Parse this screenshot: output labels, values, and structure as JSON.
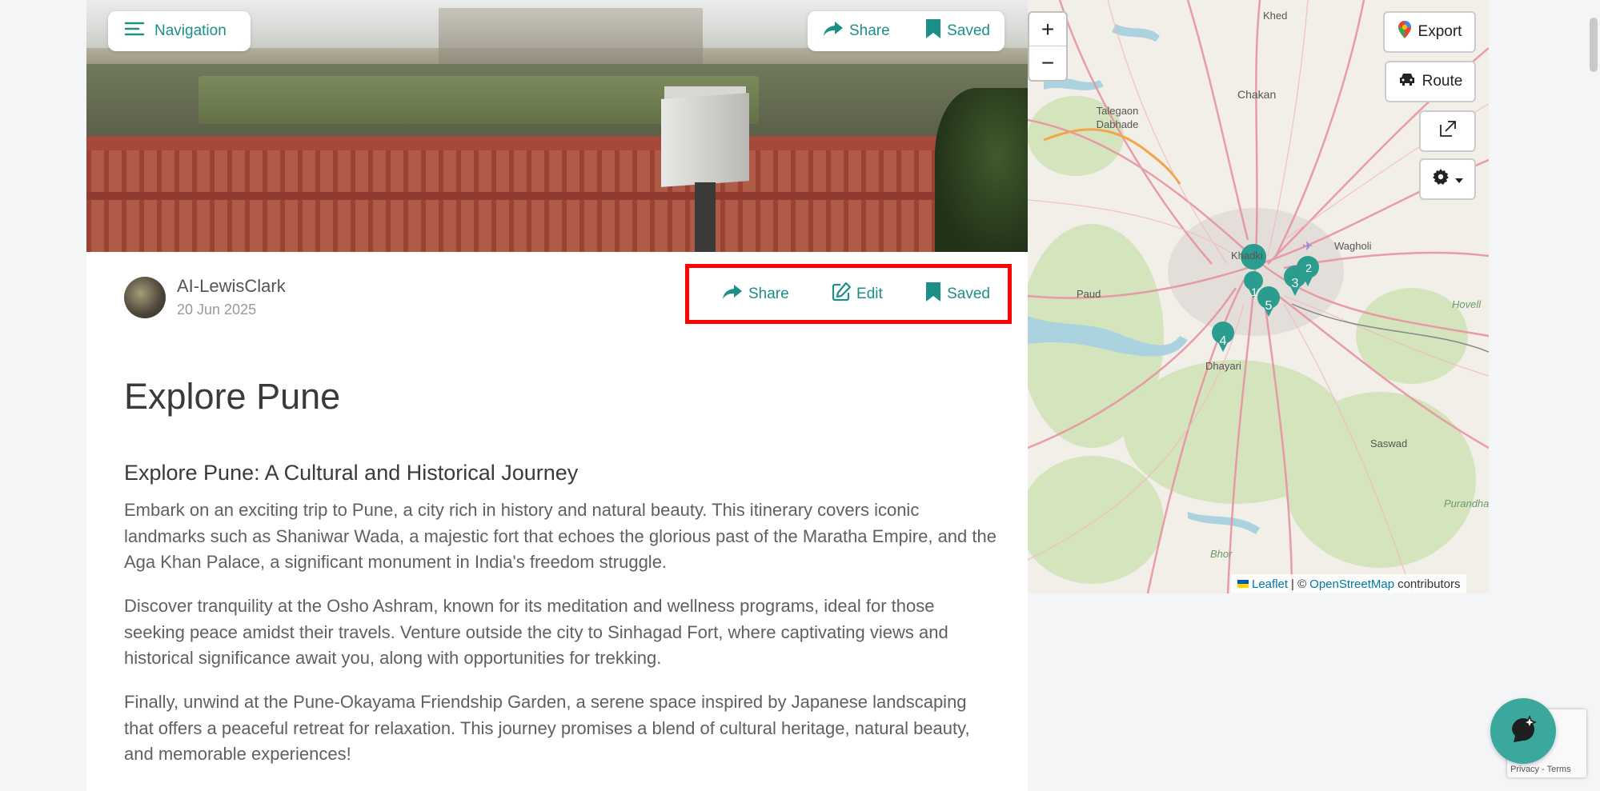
{
  "hero": {
    "nav_label": "Navigation",
    "share_label": "Share",
    "saved_label": "Saved"
  },
  "author": {
    "name": "AI-LewisClark",
    "date": "20 Jun 2025"
  },
  "actions": {
    "share_label": "Share",
    "edit_label": "Edit",
    "saved_label": "Saved"
  },
  "article": {
    "title": "Explore Pune",
    "subtitle": "Explore Pune: A Cultural and Historical Journey",
    "paragraphs": [
      "Embark on an exciting trip to Pune, a city rich in history and natural beauty. This itinerary covers iconic landmarks such as Shaniwar Wada, a majestic fort that echoes the glorious past of the Maratha Empire, and the Aga Khan Palace, a significant monument in India's freedom struggle.",
      "Discover tranquility at the Osho Ashram, known for its meditation and wellness programs, ideal for those seeking peace amidst their travels. Venture outside the city to Sinhagad Fort, where captivating views and historical significance await you, along with opportunities for trekking.",
      "Finally, unwind at the Pune-Okayama Friendship Garden, a serene space inspired by Japanese landscaping that offers a peaceful retreat for relaxation. This journey promises a blend of cultural heritage, natural beauty, and memorable experiences!"
    ]
  },
  "map": {
    "zoom_in": "+",
    "zoom_out": "−",
    "export_label": "Export",
    "route_label": "Route",
    "place_labels": [
      "Khed",
      "Chakan",
      "Talegaon Dabhade",
      "Khadki",
      "Wagholi",
      "Paud",
      "Dhayari",
      "Saswad",
      "Hovell",
      "Purandhar",
      "Bhor"
    ],
    "markers": [
      "1",
      "2",
      "3",
      "4",
      "5"
    ],
    "attribution": {
      "leaflet": "Leaflet",
      "sep": "| ©",
      "osm": "OpenStreetMap",
      "contributors": "contributors"
    }
  },
  "recaptcha": {
    "links": "Privacy - Terms"
  },
  "colors": {
    "accent": "#1c8f88",
    "highlight": "#ff0000",
    "marker": "#2a9d8f"
  }
}
